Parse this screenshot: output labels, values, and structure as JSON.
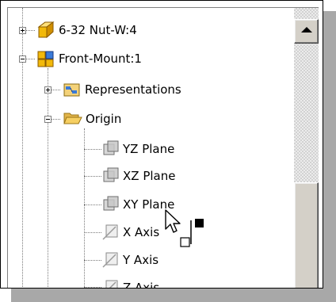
{
  "tree": {
    "items": [
      {
        "label": "6-32 Nut-W:4",
        "icon": "part-icon"
      },
      {
        "label": "Front-Mount:1",
        "icon": "assembly-icon"
      },
      {
        "label": "Representations",
        "icon": "representations-icon"
      },
      {
        "label": "Origin",
        "icon": "folder-open-icon"
      },
      {
        "label": "YZ Plane",
        "icon": "plane-icon"
      },
      {
        "label": "XZ Plane",
        "icon": "plane-icon"
      },
      {
        "label": "XY Plane",
        "icon": "plane-icon"
      },
      {
        "label": "X Axis",
        "icon": "axis-icon"
      },
      {
        "label": "Y Axis",
        "icon": "axis-icon"
      },
      {
        "label": "Z Axis",
        "icon": "axis-icon"
      }
    ]
  },
  "colors": {
    "part": "#f2b90a",
    "folder": "#f6cf62",
    "plane": "#a0a0a0",
    "scrollbar": "#d4d0c8"
  }
}
